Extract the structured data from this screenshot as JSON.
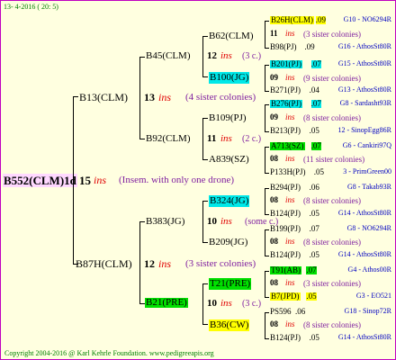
{
  "header": {
    "date": "13- 4-2016 ( 20: 5)"
  },
  "footer": {
    "text": "Copyright 2004-2016 @ Karl Kehrle Foundation.   www.pedigreeapis.org"
  },
  "root": {
    "name": "B552(CLM)1d",
    "num": "15",
    "ins": "ins",
    "note": "(Insem. with only one drone)"
  },
  "g1": [
    {
      "name": "B13(CLM)",
      "num": "13",
      "ins": "ins",
      "note": "(4 sister colonies)"
    },
    {
      "name": "B87H(CLM)",
      "num": "12",
      "ins": "ins",
      "note": "(3 sister colonies)"
    }
  ],
  "g2": [
    {
      "name": "B45(CLM)",
      "num": "12",
      "ins": "ins",
      "note": "(3 c.)"
    },
    {
      "name": "B92(CLM)",
      "num": "11",
      "ins": "ins",
      "note": "(2 c.)"
    },
    {
      "name": "B383(JG)",
      "num": "10",
      "ins": "ins",
      "note": "(some c.)"
    },
    {
      "name": "B21(PRE)",
      "num": "10",
      "ins": "ins",
      "note": "(3 c.)"
    }
  ],
  "g3": [
    {
      "name": "B62(CLM)",
      "num": "11",
      "ins": "ins",
      "note": "(3 sister colonies)"
    },
    {
      "name": "B100(JG)",
      "num": "09",
      "ins": "ins",
      "note": "(9 sister colonies)"
    },
    {
      "name": "B109(PJ)",
      "num": "09",
      "ins": "ins",
      "note": "(8 sister colonies)"
    },
    {
      "name": "A839(SZ)",
      "num": "08",
      "ins": "ins",
      "note": "(11 sister colonies)"
    },
    {
      "name": "B324(JG)",
      "num": "08",
      "ins": "ins",
      "note": "(8 sister colonies)"
    },
    {
      "name": "B209(JG)",
      "num": "08",
      "ins": "ins",
      "note": "(8 sister colonies)"
    },
    {
      "name": "T21(PRE)",
      "num": "08",
      "ins": "ins",
      "note": "(3 sister colonies)"
    },
    {
      "name": "B36(CW)",
      "num": "08",
      "ins": "ins",
      "note": "(8 sister colonies)"
    }
  ],
  "g4": [
    {
      "q": "B26H(CLM)",
      "y": ".09",
      "f": "G10 - NO6294R"
    },
    {
      "q": "B98(PJ)",
      "y": ".09",
      "f": "G16 - AthosSt80R"
    },
    {
      "q": "B201(PJ)",
      "y": ".07",
      "f": "G15 - AthosSt80R"
    },
    {
      "q": "B271(PJ)",
      "y": ".04",
      "f": "G13 - AthosSt80R"
    },
    {
      "q": "B276(PJ)",
      "y": ".07",
      "f": "G8 - Sardasht93R"
    },
    {
      "q": "B213(PJ)",
      "y": ".05",
      "f": "12 - SinopEgg86R"
    },
    {
      "q": "A713(SZ)",
      "y": ".07",
      "f": "G6 - Cankiri97Q"
    },
    {
      "q": "P133H(PJ)",
      "y": ".05",
      "f": "3 - PrimGreen00"
    },
    {
      "q": "B294(PJ)",
      "y": ".06",
      "f": "G8 - Takab93R"
    },
    {
      "q": "B124(PJ)",
      "y": ".05",
      "f": "G14 - AthosSt80R"
    },
    {
      "q": "B199(PJ)",
      "y": ".07",
      "f": "G8 - NO6294R"
    },
    {
      "q": "B124(PJ)",
      "y": ".05",
      "f": "G14 - AthosSt80R"
    },
    {
      "q": "T91(AB)",
      "y": ".07",
      "f": "G4 - Athos00R"
    },
    {
      "q": "B7(JPD)",
      "y": ".05",
      "f": "G3 - EO521"
    },
    {
      "q": "PS596",
      "y": ".06",
      "f": "G18 - Sinop72R"
    },
    {
      "q": "B124(PJ)",
      "y": ".05",
      "f": "G14 - AthosSt80R"
    }
  ]
}
